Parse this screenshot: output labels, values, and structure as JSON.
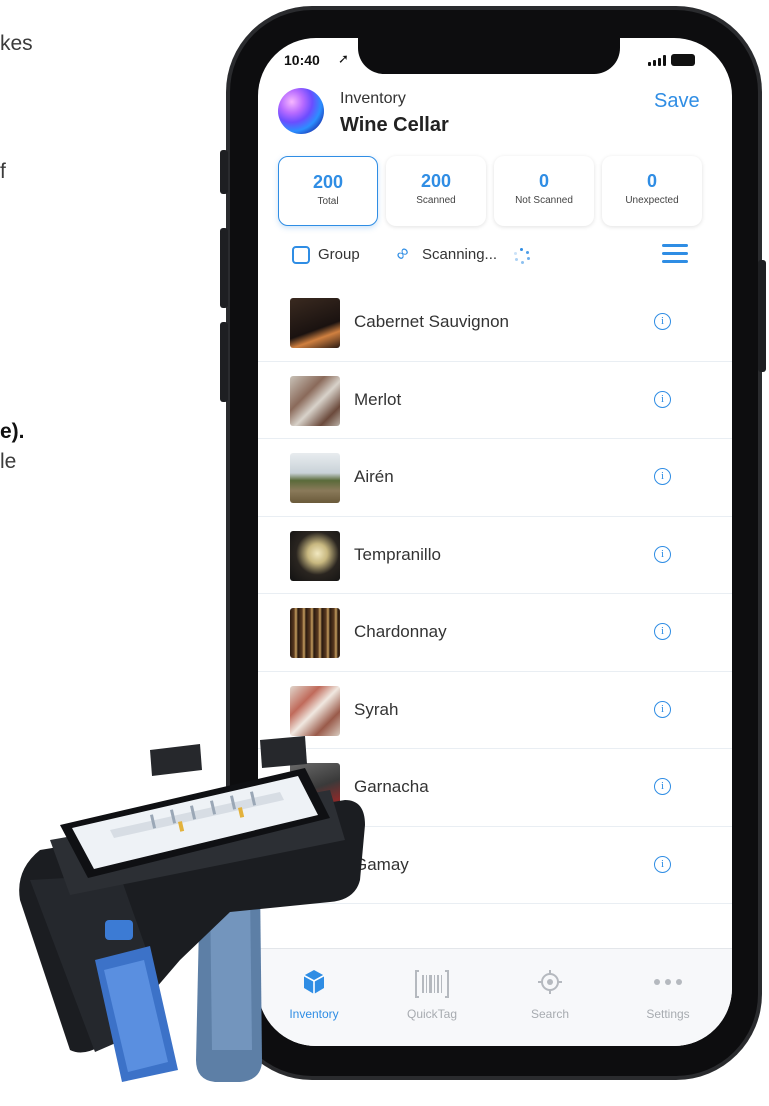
{
  "side_text": {
    "line1": "kes",
    "line2": "f",
    "line3": "e).",
    "line4": "le"
  },
  "status": {
    "time": "10:40",
    "location_icon": "location-arrow-icon"
  },
  "header": {
    "subtitle": "Inventory",
    "title": "Wine Cellar",
    "save_label": "Save"
  },
  "stats": [
    {
      "value": "200",
      "label": "Total",
      "active": true
    },
    {
      "value": "200",
      "label": "Scanned",
      "active": false
    },
    {
      "value": "0",
      "label": "Not Scanned",
      "active": false
    },
    {
      "value": "0",
      "label": "Unexpected",
      "active": false
    }
  ],
  "controls": {
    "group_label": "Group",
    "group_checked": false,
    "scanning_label": "Scanning..."
  },
  "items": [
    {
      "name": "Cabernet Sauvignon",
      "thumb": "wine-glass-photo"
    },
    {
      "name": "Merlot",
      "thumb": "people-drinking-photo"
    },
    {
      "name": "Airén",
      "thumb": "vineyard-photo"
    },
    {
      "name": "Tempranillo",
      "thumb": "white-wine-glass-photo"
    },
    {
      "name": "Chardonnay",
      "thumb": "wine-bottle-shelf-photo"
    },
    {
      "name": "Syrah",
      "thumb": "friends-toasting-photo"
    },
    {
      "name": "Garnacha",
      "thumb": "wine-pour-photo"
    },
    {
      "name": "Gamay",
      "thumb": "dark-wine-photo"
    }
  ],
  "tabs": [
    {
      "label": "Inventory",
      "icon": "cube-icon",
      "active": true
    },
    {
      "label": "QuickTag",
      "icon": "barcode-icon",
      "active": false
    },
    {
      "label": "Search",
      "icon": "target-icon",
      "active": false
    },
    {
      "label": "Settings",
      "icon": "more-dots-icon",
      "active": false
    }
  ],
  "colors": {
    "accent": "#2f8de4",
    "text": "#333333",
    "tab_inactive": "#a7abb0"
  }
}
